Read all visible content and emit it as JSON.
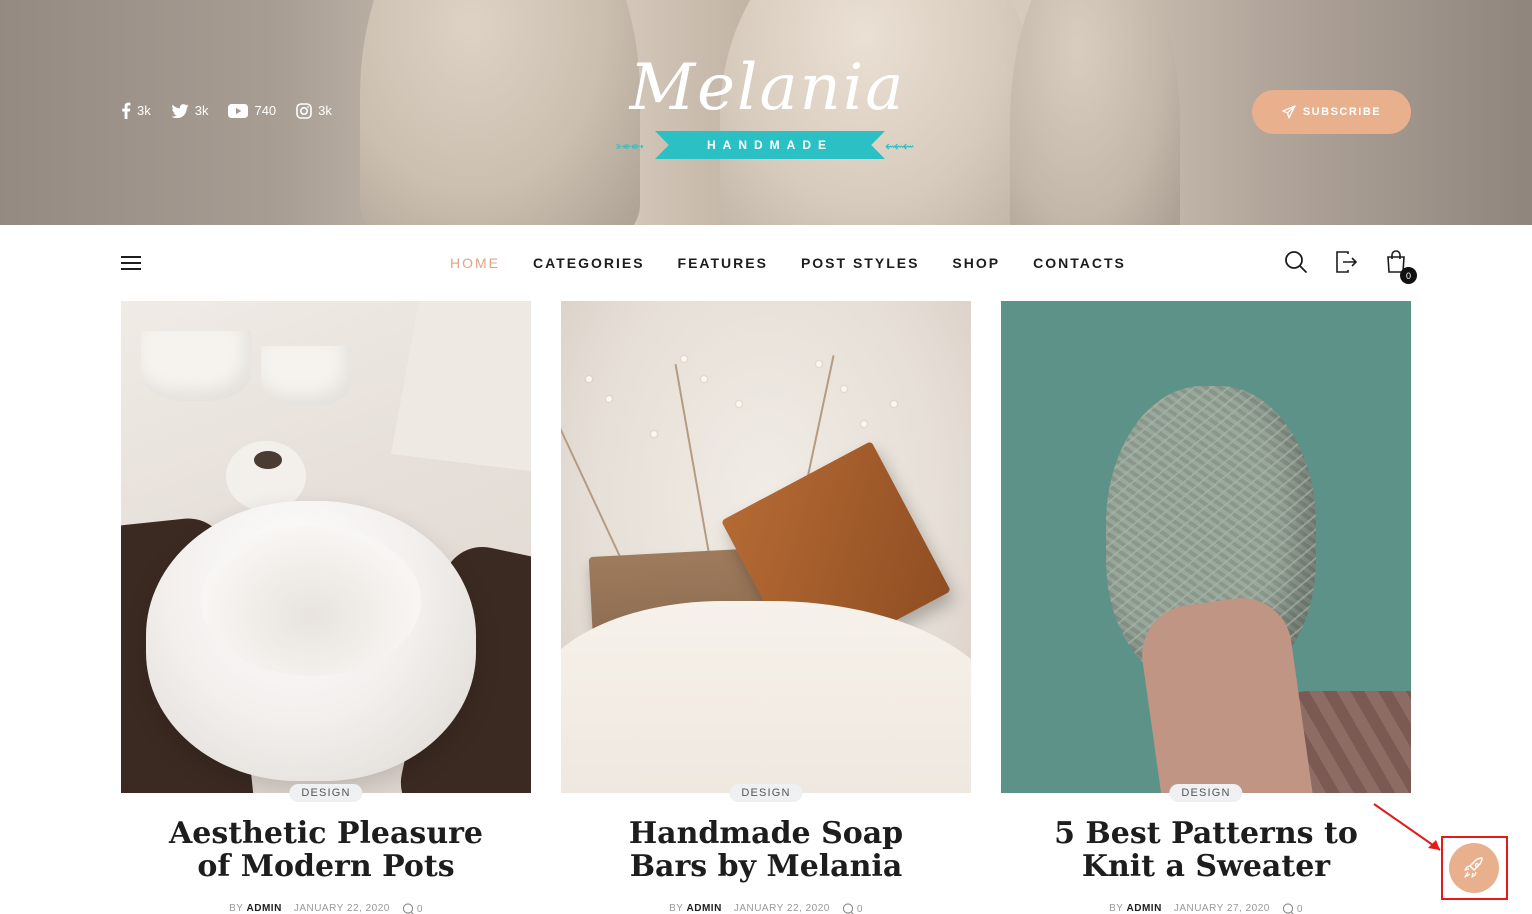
{
  "hero": {
    "logo_script": "Melania",
    "logo_ribbon": "HANDMADE",
    "social": [
      {
        "icon": "facebook-icon",
        "count": "3k"
      },
      {
        "icon": "twitter-icon",
        "count": "3k"
      },
      {
        "icon": "youtube-icon",
        "count": "740"
      },
      {
        "icon": "instagram-icon",
        "count": "3k"
      }
    ],
    "subscribe_label": "SUBSCRIBE"
  },
  "nav": {
    "items": [
      "HOME",
      "CATEGORIES",
      "FEATURES",
      "POST STYLES",
      "SHOP",
      "CONTACTS"
    ],
    "active": "HOME",
    "cart_count": "0"
  },
  "posts": [
    {
      "category": "DESIGN",
      "title": "Aesthetic Pleasure of Modern Pots",
      "by": "BY",
      "author": "ADMIN",
      "date": "JANUARY 22, 2020",
      "comments": "0"
    },
    {
      "category": "DESIGN",
      "title": "Handmade Soap Bars by Melania",
      "by": "BY",
      "author": "ADMIN",
      "date": "JANUARY 22, 2020",
      "comments": "0"
    },
    {
      "category": "DESIGN",
      "title": "5 Best Patterns to Knit a Sweater",
      "by": "BY",
      "author": "ADMIN",
      "date": "JANUARY 27, 2020",
      "comments": "0"
    }
  ],
  "colors": {
    "accent": "#e9b08d",
    "active_nav": "#e0a483",
    "ribbon": "#2bc0c4",
    "annotation": "#e21b1b"
  },
  "floating_button": {
    "icon": "rocket-icon"
  }
}
